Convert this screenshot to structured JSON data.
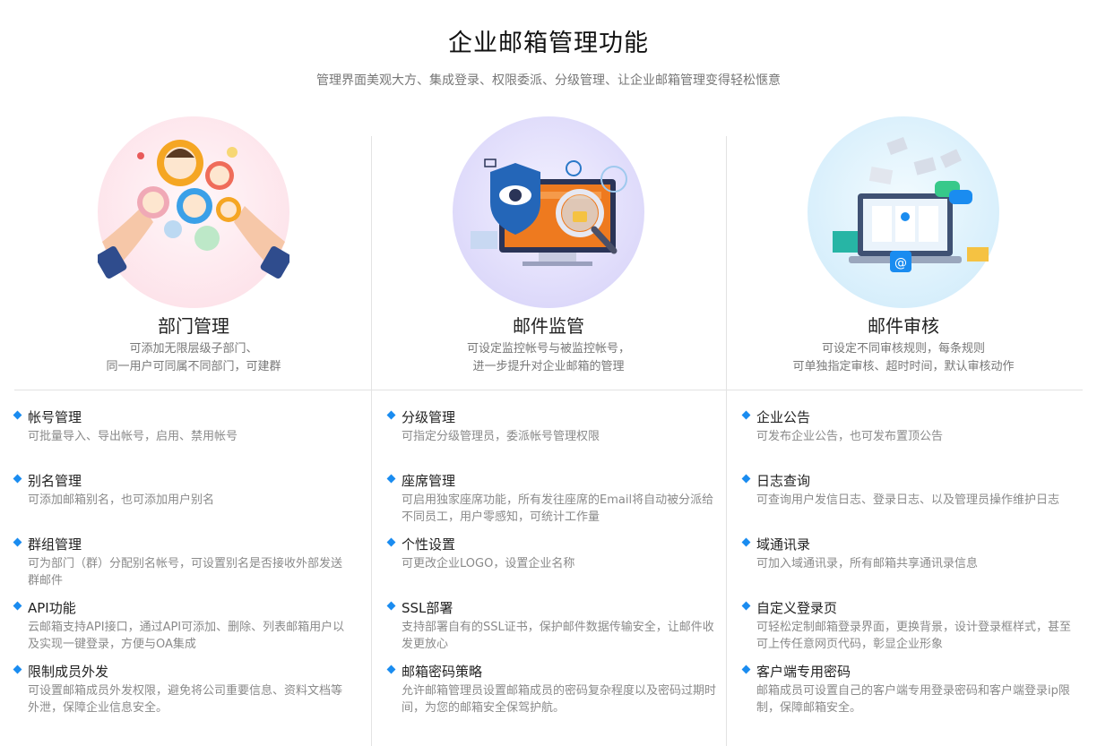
{
  "header": {
    "title": "企业邮箱管理功能",
    "subtitle": "管理界面美观大方、集成登录、权限委派、分级管理、让企业邮箱管理变得轻松惬意"
  },
  "features": [
    {
      "icon": "people-gears-icon",
      "title": "部门管理",
      "desc1": "可添加无限层级子部门、",
      "desc2": "同一用户可同属不同部门，可建群"
    },
    {
      "icon": "monitor-shield-icon",
      "title": "邮件监管",
      "desc1": "可设定监控帐号与被监控帐号，",
      "desc2": "进一步提升对企业邮箱的管理"
    },
    {
      "icon": "laptop-mail-icon",
      "title": "邮件审核",
      "desc1": "可设定不同审核规则，每条规则",
      "desc2": "可单独指定审核、超时时间，默认审核动作"
    }
  ],
  "columns": [
    [
      {
        "title": "帐号管理",
        "desc": "可批量导入、导出帐号，启用、禁用帐号"
      },
      {
        "title": "别名管理",
        "desc": "可添加邮箱别名，也可添加用户别名"
      },
      {
        "title": "群组管理",
        "desc": "可为部门（群）分配别名帐号，可设置别名是否接收外部发送群邮件"
      },
      {
        "title": "API功能",
        "desc": "云邮箱支持API接口，通过API可添加、删除、列表邮箱用户以及实现一键登录，方便与OA集成"
      },
      {
        "title": "限制成员外发",
        "desc": "可设置邮箱成员外发权限，避免将公司重要信息、资料文档等外泄，保障企业信息安全。"
      }
    ],
    [
      {
        "title": "分级管理",
        "desc": "可指定分级管理员，委派帐号管理权限"
      },
      {
        "title": "座席管理",
        "desc": "可启用独家座席功能，所有发往座席的Email将自动被分派给不同员工，用户零感知，可统计工作量"
      },
      {
        "title": "个性设置",
        "desc": "可更改企业LOGO，设置企业名称"
      },
      {
        "title": "SSL部署",
        "desc": "支持部署自有的SSL证书，保护邮件数据传输安全，让邮件收发更放心"
      },
      {
        "title": "邮箱密码策略",
        "desc": "允许邮箱管理员设置邮箱成员的密码复杂程度以及密码过期时间，为您的邮箱安全保驾护航。"
      }
    ],
    [
      {
        "title": "企业公告",
        "desc": "可发布企业公告，也可发布置顶公告"
      },
      {
        "title": "日志查询",
        "desc": "可查询用户发信日志、登录日志、以及管理员操作维护日志"
      },
      {
        "title": "域通讯录",
        "desc": "可加入域通讯录，所有邮箱共享通讯录信息"
      },
      {
        "title": "自定义登录页",
        "desc": "可轻松定制邮箱登录界面，更换背景，设计登录框样式，甚至可上传任意网页代码，彰显企业形象"
      },
      {
        "title": "客户端专用密码",
        "desc": "邮箱成员可设置自己的客户端专用登录密码和客户端登录ip限制，保障邮箱安全。"
      }
    ]
  ],
  "colors": {
    "accent": "#1a8cf0",
    "divider": "#e3e3e3"
  }
}
